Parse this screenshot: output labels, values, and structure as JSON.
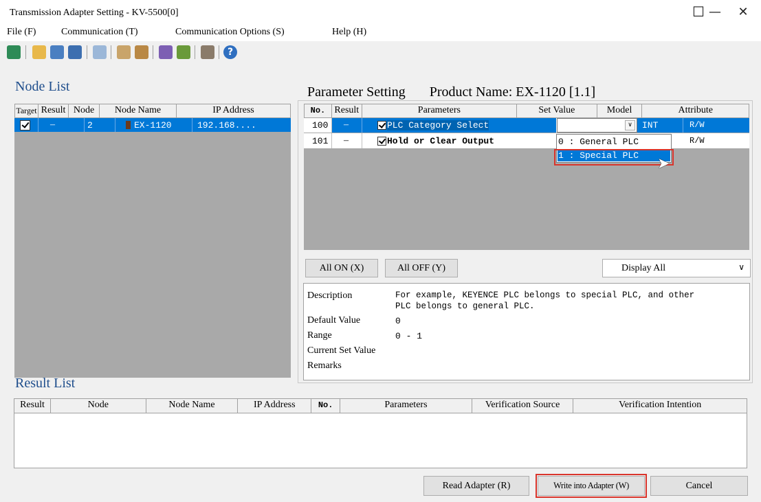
{
  "window": {
    "title": "Transmission Adapter Setting - KV-5500[0]",
    "controls": {
      "minimize": "—",
      "maximize": "☐",
      "close": "✕"
    }
  },
  "menu": [
    "File (F)",
    "Communication (T)",
    "Communication Options (S)",
    "Help (H)"
  ],
  "toolbar": {
    "icons": [
      "connect-icon",
      "open-folder-icon",
      "save-icon",
      "save-as-icon",
      "print-preview-icon",
      "copy-icon",
      "paste-icon",
      "read-icon",
      "write-icon",
      "search-icon",
      "help-icon"
    ]
  },
  "node_list": {
    "title": "Node List",
    "columns": [
      "Target",
      "Result",
      "Node",
      "Node Name",
      "IP Address"
    ],
    "rows": [
      {
        "result": "–",
        "node": "2",
        "name": "EX-1120",
        "ip": "192.168...."
      }
    ]
  },
  "parameter_setting": {
    "title": "Parameter Setting",
    "product": "Product Name: EX-1120 [1.1]",
    "columns": [
      "No.",
      "Result",
      "Parameters",
      "Set Value",
      "Model",
      "Attribute"
    ],
    "rows": [
      {
        "no": "100",
        "result": "–",
        "param": "PLC Category Select",
        "model": "INT",
        "attr": "R/W"
      },
      {
        "no": "101",
        "result": "–",
        "param": "Hold or Clear Output",
        "model": "",
        "attr": "R/W"
      }
    ],
    "dropdown_options": [
      "0 : General PLC",
      "1 : Special PLC"
    ]
  },
  "controls": {
    "all_on": "All ON (X)",
    "all_off": "All OFF (Y)",
    "display_select": "Display All"
  },
  "description": {
    "label_description": "Description",
    "description_line1": "For example, KEYENCE PLC belongs to special PLC, and other",
    "description_line2": "PLC belongs to general PLC.",
    "label_default": "Default Value",
    "default_value": "0",
    "label_range": "Range",
    "range": "0 - 1",
    "label_current": "Current Set Value",
    "label_remarks": "Remarks"
  },
  "result_list": {
    "title": "Result List",
    "columns": [
      "Result",
      "Node",
      "Node Name",
      "IP Address",
      "No.",
      "Parameters",
      "Verification Source",
      "Verification Intention"
    ]
  },
  "buttons": {
    "read": "Read Adapter (R)",
    "write": "Write into Adapter (W)",
    "cancel": "Cancel"
  },
  "colors": {
    "selection": "#0078d7",
    "highlight_box": "#d9342b",
    "panel_gray": "#a9a9a9",
    "title_blue": "#1f4e8c"
  }
}
